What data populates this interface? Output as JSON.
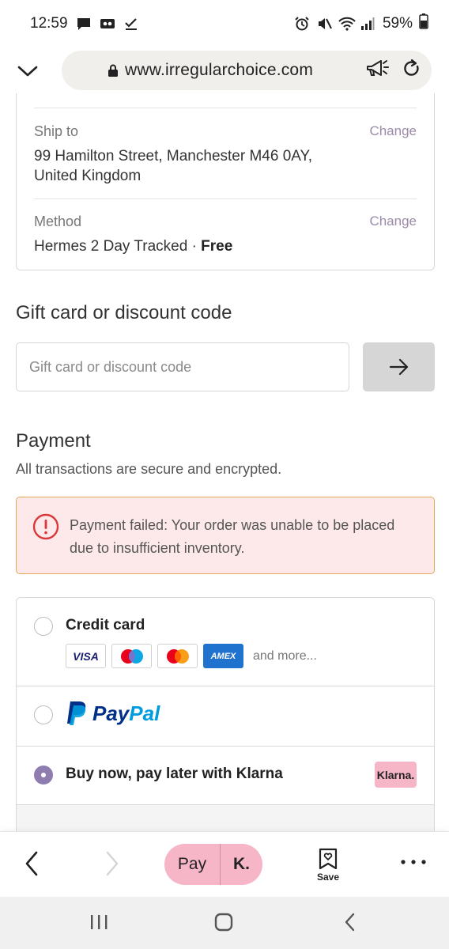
{
  "status_bar": {
    "time": "12:59",
    "battery": "59%",
    "left_icons": [
      "chat-icon",
      "voicemail-icon",
      "check-icon"
    ],
    "right_icons": [
      "alarm-icon",
      "mute-icon",
      "wifi-icon",
      "signal-icon",
      "battery-icon"
    ]
  },
  "browser": {
    "url": "www.irregularchoice.com"
  },
  "shipping": {
    "ship_to_label": "Ship to",
    "ship_to_change": "Change",
    "address_line1": "99 Hamilton Street, Manchester M46 0AY,",
    "address_line2": "United Kingdom",
    "method_label": "Method",
    "method_change": "Change",
    "method_name": "Hermes 2 Day Tracked · ",
    "method_price": "Free"
  },
  "gift": {
    "title": "Gift card or discount code",
    "placeholder": "Gift card or discount code"
  },
  "payment": {
    "title": "Payment",
    "subtitle": "All transactions are secure and encrypted.",
    "error": "Payment failed: Your order was unable to be placed due to insufficient inventory.",
    "methods": {
      "credit_card": {
        "label": "Credit card",
        "and_more": "and more...",
        "logos": [
          "VISA",
          "Maestro",
          "Mastercard",
          "AMEX"
        ]
      },
      "paypal": {
        "label_pay": "Pay",
        "label_pal": "Pal"
      },
      "klarna": {
        "label": "Buy now, pay later with Klarna",
        "badge": "Klarna."
      }
    },
    "selected_method": "klarna"
  },
  "toolbar": {
    "pay_label": "Pay",
    "klarna_short": "K.",
    "save_label": "Save"
  },
  "colors": {
    "accent_purple": "#8f7db0",
    "klarna_pink": "#f6b6c8",
    "error_bg": "#fde9e9",
    "error_border": "#e2a95c",
    "error_icon": "#d9373a"
  }
}
